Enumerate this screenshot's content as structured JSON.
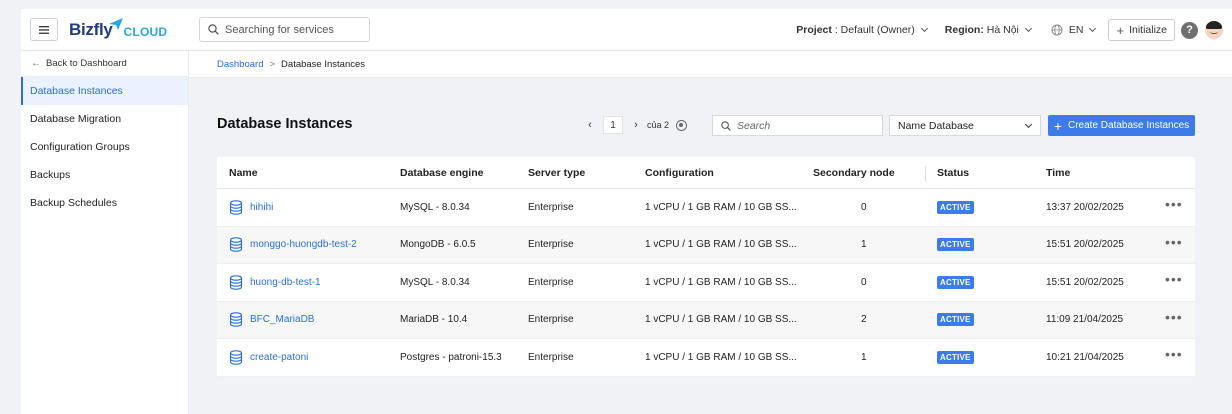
{
  "header": {
    "logo_main": "Bizfly",
    "logo_sub": "CLOUD",
    "search_placeholder": "Searching for services",
    "project_label": "Project",
    "project_value": ": Default (Owner)",
    "region_label": "Region:",
    "region_value": "Hà Nội",
    "language": "EN",
    "initialize_label": "Initialize",
    "help_label": "?"
  },
  "sidebar": {
    "back_label": "Back to Dashboard",
    "items": [
      {
        "label": "Database Instances",
        "active": true
      },
      {
        "label": "Database Migration"
      },
      {
        "label": "Configuration Groups"
      },
      {
        "label": "Backups"
      },
      {
        "label": "Backup Schedules"
      }
    ]
  },
  "breadcrumb": {
    "root": "Dashboard",
    "separator": ">",
    "current": "Database Instances"
  },
  "main": {
    "title": "Database Instances",
    "pagination": {
      "prev": "‹",
      "page": "1",
      "of_label": "của 2",
      "next": "›"
    },
    "search_placeholder": "Search",
    "filter_value": "Name Database",
    "create_label": "Create Database Instances"
  },
  "table": {
    "columns": {
      "name": "Name",
      "engine": "Database engine",
      "server": "Server type",
      "config": "Configuration",
      "secondary": "Secondary node",
      "status": "Status",
      "time": "Time"
    },
    "rows": [
      {
        "name": "hihihi",
        "engine": "MySQL - 8.0.34",
        "server": "Enterprise",
        "config": "1 vCPU / 1 GB RAM / 10 GB SS...",
        "secondary": "0",
        "status": "ACTIVE",
        "time": "13:37 20/02/2025",
        "more": "•••"
      },
      {
        "name": "monggo-huongdb-test-2",
        "engine": "MongoDB - 6.0.5",
        "server": "Enterprise",
        "config": "1 vCPU / 1 GB RAM / 10 GB SS...",
        "secondary": "1",
        "status": "ACTIVE",
        "time": "15:51 20/02/2025",
        "more": "•••"
      },
      {
        "name": "huong-db-test-1",
        "engine": "MySQL - 8.0.34",
        "server": "Enterprise",
        "config": "1 vCPU / 1 GB RAM / 10 GB SS...",
        "secondary": "0",
        "status": "ACTIVE",
        "time": "15:51 20/02/2025",
        "more": "•••"
      },
      {
        "name": "BFC_MariaDB",
        "engine": "MariaDB - 10.4",
        "server": "Enterprise",
        "config": "1 vCPU / 1 GB RAM / 10 GB SS...",
        "secondary": "2",
        "status": "ACTIVE",
        "time": "11:09 21/04/2025",
        "more": "•••"
      },
      {
        "name": "create-patoni",
        "engine": "Postgres - patroni-15.3",
        "server": "Enterprise",
        "config": "1 vCPU / 1 GB RAM / 10 GB SS...",
        "secondary": "1",
        "status": "ACTIVE",
        "time": "10:21 21/04/2025",
        "more": "•••"
      }
    ]
  },
  "colors": {
    "accent": "#3b7bea",
    "link": "#2b6fd6",
    "sidebar_active_bg": "#eaf2ff"
  },
  "icons": [
    "hamburger-icon",
    "search-icon",
    "globe-icon",
    "plus-icon",
    "help-icon",
    "avatar",
    "arrow-left-icon",
    "gear-icon",
    "database-icon",
    "more-icon",
    "chevron-down-icon"
  ]
}
